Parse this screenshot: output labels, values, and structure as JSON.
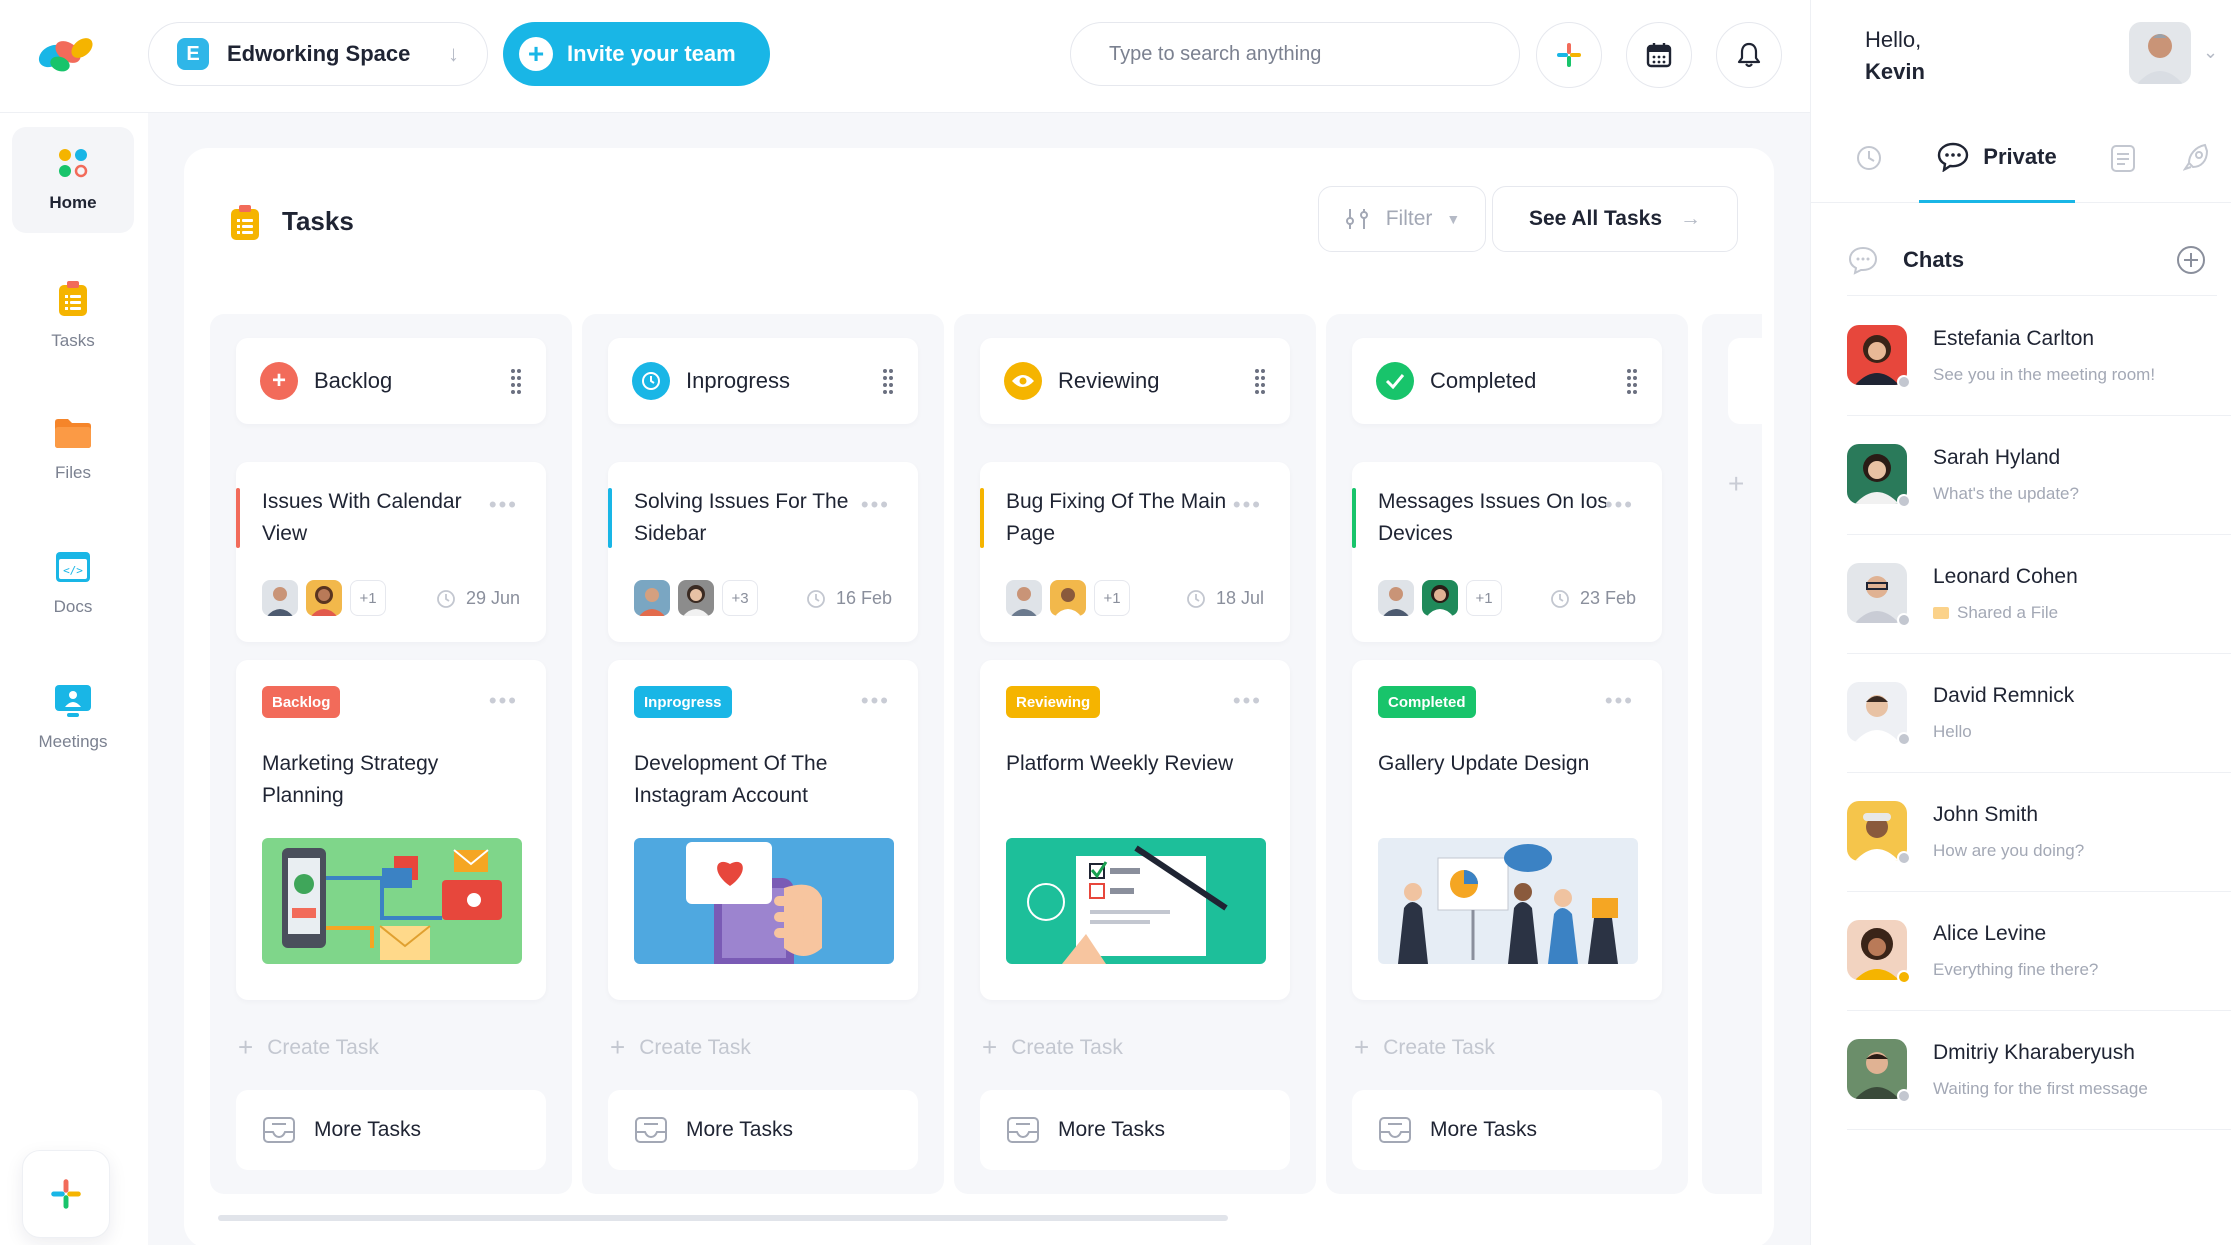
{
  "header": {
    "workspace_initial": "E",
    "workspace_name": "Edworking Space",
    "invite_label": "Invite your team",
    "search_placeholder": "Type to search anything"
  },
  "nav": {
    "items": [
      {
        "label": "Home",
        "icon": "home-grid-icon"
      },
      {
        "label": "Tasks",
        "icon": "tasks-clipboard-icon"
      },
      {
        "label": "Files",
        "icon": "folder-icon"
      },
      {
        "label": "Docs",
        "icon": "code-doc-icon"
      },
      {
        "label": "Meetings",
        "icon": "monitor-icon"
      }
    ]
  },
  "tasks_panel": {
    "title": "Tasks",
    "filter_label": "Filter",
    "see_all_label": "See All Tasks",
    "create_label": "Create Task",
    "more_label": "More Tasks",
    "columns": [
      {
        "name": "Backlog",
        "color": "#f26b5a",
        "card1": {
          "title": "Issues With Calendar View",
          "extra": "+1",
          "due": "29 Jun"
        },
        "card2": {
          "tag": "Backlog",
          "title": "Marketing Strategy Planning"
        }
      },
      {
        "name": "Inprogress",
        "color": "#19b6e6",
        "card1": {
          "title": "Solving Issues For The Sidebar",
          "extra": "+3",
          "due": "16 Feb"
        },
        "card2": {
          "tag": "Inprogress",
          "title": "Development Of The Instagram Account"
        }
      },
      {
        "name": "Reviewing",
        "color": "#f5b400",
        "card1": {
          "title": "Bug Fixing Of The Main Page",
          "extra": "+1",
          "due": "18 Jul"
        },
        "card2": {
          "tag": "Reviewing",
          "title": "Platform Weekly Review"
        }
      },
      {
        "name": "Completed",
        "color": "#18c46b",
        "card1": {
          "title": "Messages Issues On Ios Devices",
          "extra": "+1",
          "due": "23 Feb"
        },
        "card2": {
          "tag": "Completed",
          "title": "Gallery Update Design"
        }
      }
    ]
  },
  "user": {
    "greeting": "Hello,",
    "name": "Kevin"
  },
  "right_tabs": {
    "active_label": "Private"
  },
  "chats": {
    "title": "Chats",
    "items": [
      {
        "name": "Estefania Carlton",
        "message": "See you in the meeting room!"
      },
      {
        "name": "Sarah Hyland",
        "message": "What's the update?"
      },
      {
        "name": "Leonard Cohen",
        "message": "Shared a File"
      },
      {
        "name": "David Remnick",
        "message": "Hello"
      },
      {
        "name": "John Smith",
        "message": "How are you doing?"
      },
      {
        "name": "Alice Levine",
        "message": "Everything fine there?"
      },
      {
        "name": "Dmitriy Kharaberyush",
        "message": "Waiting for the first message"
      }
    ]
  }
}
